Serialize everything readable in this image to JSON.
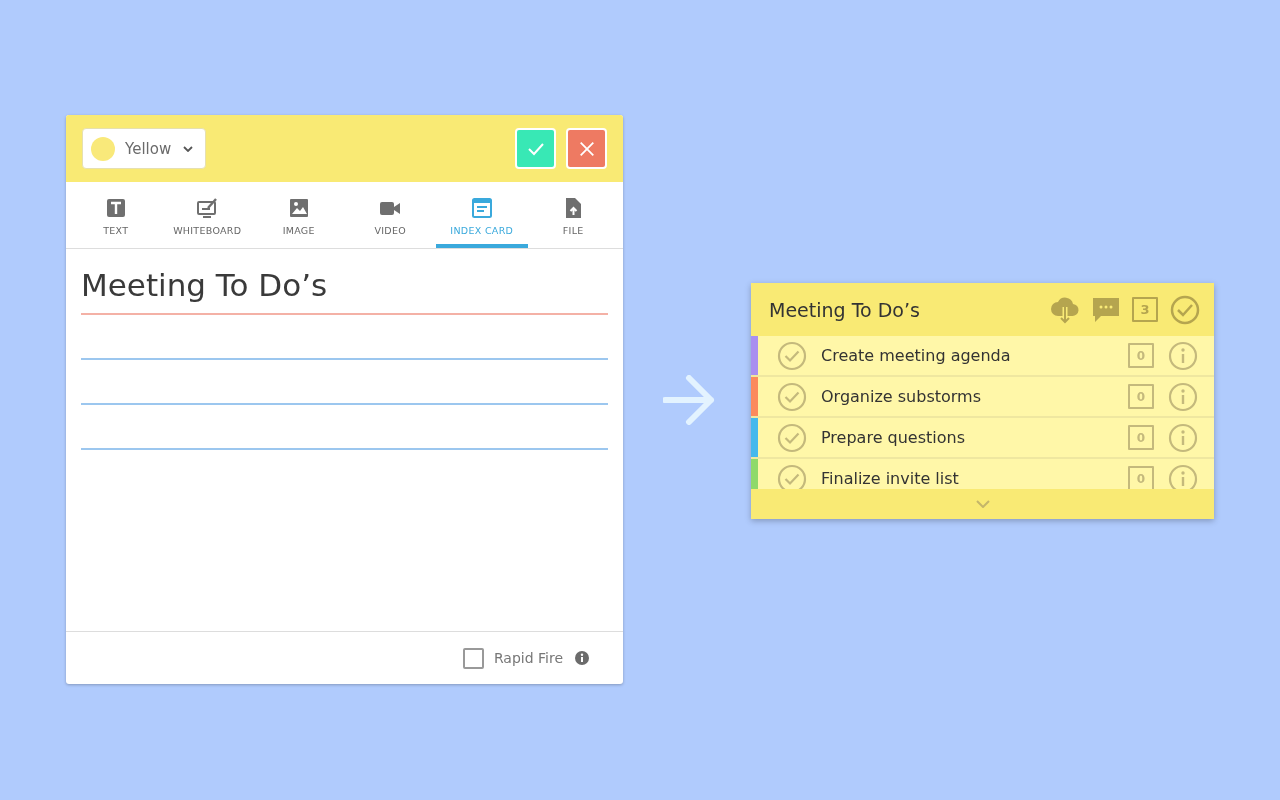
{
  "editor": {
    "color_select": {
      "value": "Yellow"
    },
    "tabs": [
      {
        "label": "TEXT",
        "kind": "text",
        "selected": false
      },
      {
        "label": "WHITEBOARD",
        "kind": "whiteboard",
        "selected": false
      },
      {
        "label": "IMAGE",
        "kind": "image",
        "selected": false
      },
      {
        "label": "VIDEO",
        "kind": "video",
        "selected": false
      },
      {
        "label": "INDEX CARD",
        "kind": "card",
        "selected": true
      },
      {
        "label": "FILE",
        "kind": "file",
        "selected": false
      }
    ],
    "title": "Meeting To Do’s",
    "rapid_fire": {
      "label": "Rapid Fire",
      "checked": false
    }
  },
  "card": {
    "title": "Meeting To Do’s",
    "count": "3",
    "items": [
      {
        "text": "Create meeting agenda",
        "count": "0",
        "color": "#a98ff0"
      },
      {
        "text": "Organize substorms",
        "count": "0",
        "color": "#fb8a5c"
      },
      {
        "text": "Prepare questions",
        "count": "0",
        "color": "#45b8ec"
      },
      {
        "text": "Finalize invite list",
        "count": "0",
        "color": "#8fd96a"
      }
    ]
  }
}
